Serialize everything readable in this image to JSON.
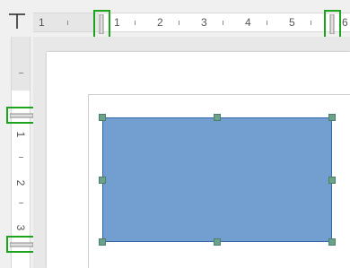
{
  "ruler": {
    "horizontal_numbers": [
      "1",
      "1",
      "2",
      "3",
      "4",
      "5",
      "6"
    ],
    "vertical_numbers": [
      "1",
      "2",
      "3"
    ]
  },
  "colors": {
    "shape_fill": "#729fcf",
    "shape_border": "#3465a4",
    "handle": "#6aa28a",
    "highlight": "#1ea31e"
  },
  "icons": [
    "tab-stop-icon",
    "margin-marker-icon"
  ]
}
